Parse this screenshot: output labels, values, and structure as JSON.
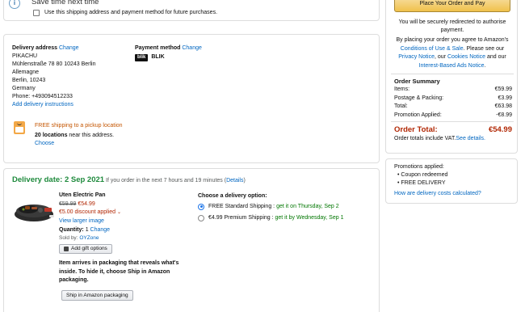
{
  "save_box": {
    "title": "Save time next time",
    "checkbox_label": "Use this shipping address and payment method for future purchases."
  },
  "delivery_address": {
    "heading": "Delivery address",
    "change": "Change",
    "lines": [
      "PIKACHU",
      "Mühlenstraße 78 80 10243 Berlin",
      "Allemagne",
      "Berlin, 10243",
      "Germany",
      "Phone: +493094512233"
    ],
    "instructions_link": "Add delivery instructions",
    "pickup_offer": "FREE shipping to a pickup location",
    "locations_count": "20 locations",
    "locations_suffix": " near this address.",
    "choose": "Choose",
    "locker_icon": "amazon-locker-icon"
  },
  "payment": {
    "heading": "Payment method",
    "change": "Change",
    "logo_text": "blik",
    "method": "BLIK"
  },
  "delivery": {
    "date_label": "Delivery date: 2 Sep 2021",
    "note_pre": "If you order in the next 7 hours and 19 minutes (",
    "details": "Details",
    "note_post": ")"
  },
  "product": {
    "name": "Uten Electric Pan",
    "old_price": "€59.99",
    "price": "€54.99",
    "discount": "€5.00 discount applied",
    "view_larger": "View larger image",
    "qty_label": "Quantity:",
    "qty_value": "1",
    "qty_change": "Change",
    "sold_by_label": "Sold by:",
    "seller": "OYZone",
    "gift_button": "Add gift options",
    "packaging_text_a": "Item arrives in packaging that reveals what's inside. To hide it, choose ",
    "packaging_text_b": "Ship in Amazon packaging",
    "packaging_text_c": ".",
    "ship_button": "Ship in Amazon packaging"
  },
  "shipping": {
    "heading": "Choose a delivery option:",
    "options": [
      {
        "label": "FREE Standard Shipping",
        "sep": " : ",
        "eta": "get it on Thursday, Sep 2",
        "selected": true
      },
      {
        "label": "€4.99 Premium Shipping",
        "sep": " : ",
        "eta": "get it by Wednesday, Sep 1",
        "selected": false
      }
    ]
  },
  "summary": {
    "place_order": "Place Your Order and Pay",
    "redirect": "You will be securely redirected to authorise payment.",
    "agree_pre": "By placing your order you agree to Amazon's ",
    "conditions": "Conditions of Use & Sale",
    "agree_mid": ". Please see our ",
    "privacy": "Privacy Notice",
    "comma": ", our ",
    "cookies": "Cookies Notice",
    "and_our": " and our ",
    "ads": "Interest-Based Ads Notice",
    "period": ".",
    "heading": "Order Summary",
    "rows": [
      {
        "label": "Items:",
        "value": "€59.99"
      },
      {
        "label": "Postage & Packing:",
        "value": "€3.99"
      },
      {
        "label": "Total:",
        "value": "€63.98"
      },
      {
        "label": "Promotion Applied:",
        "value": "-€8.99"
      }
    ],
    "total_label": "Order Total:",
    "total_value": "€54.99",
    "vat_note": "Order totals include VAT.",
    "see_details": "See details.",
    "promos_heading": "Promotions applied:",
    "promos": [
      "Coupon redeemed",
      "FREE DELIVERY"
    ],
    "calc_link": "How are delivery costs calculated?"
  },
  "colors": {
    "accent_green": "#1e8a3c",
    "button_yellow": "#f0c14b",
    "price_red": "#b12704",
    "link_blue": "#0066c0"
  }
}
